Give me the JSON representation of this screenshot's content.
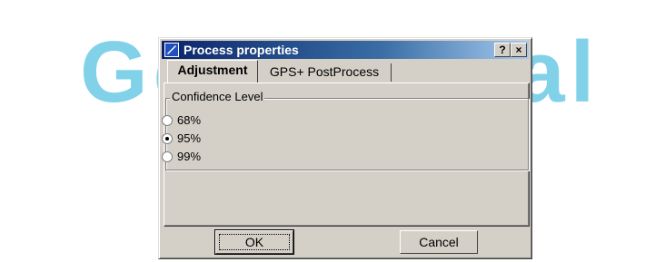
{
  "watermark": {
    "text": "Geodesical"
  },
  "dialog": {
    "title": "Process properties",
    "help_button": "?",
    "close_button": "×"
  },
  "tabs": [
    {
      "label": "Adjustment",
      "active": true
    },
    {
      "label": "GPS+ PostProcess",
      "active": false
    }
  ],
  "confidence": {
    "legend": "Confidence Level",
    "options": [
      {
        "label": "68%",
        "checked": false
      },
      {
        "label": "95%",
        "checked": true
      },
      {
        "label": "99%",
        "checked": false
      }
    ]
  },
  "buttons": {
    "ok": "OK",
    "cancel": "Cancel"
  },
  "colors": {
    "watermark": "#1aabd7",
    "title_bar": "#0a246a",
    "face": "#d4d0c8"
  }
}
